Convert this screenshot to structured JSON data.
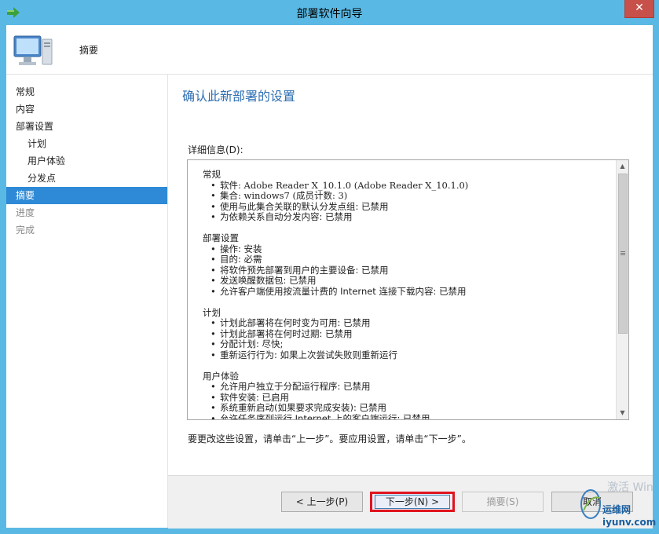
{
  "window": {
    "title": "部署软件向导",
    "close_label": "✕"
  },
  "header": {
    "title": "摘要"
  },
  "nav": {
    "items": [
      {
        "label": "常规"
      },
      {
        "label": "内容"
      },
      {
        "label": "部署设置"
      },
      {
        "label": "计划"
      },
      {
        "label": "用户体验"
      },
      {
        "label": "分发点"
      },
      {
        "label": "摘要"
      },
      {
        "label": "进度"
      },
      {
        "label": "完成"
      }
    ]
  },
  "main": {
    "heading": "确认此新部署的设置",
    "details_label": "详细信息(D):",
    "sections": [
      {
        "title": "常规",
        "items": [
          "软件: Adobe Reader X_10.1.0 (Adobe Reader X_10.1.0)",
          "集合: windows7 (成员计数: 3)",
          "使用与此集合关联的默认分发点组: 已禁用",
          "为依赖关系自动分发内容: 已禁用"
        ]
      },
      {
        "title": "部署设置",
        "items": [
          "操作: 安装",
          "目的: 必需",
          "将软件预先部署到用户的主要设备: 已禁用",
          "发送唤醒数据包: 已禁用",
          "允许客户端使用按流量计费的 Internet 连接下载内容: 已禁用"
        ]
      },
      {
        "title": "计划",
        "items": [
          "计划此部署将在何时变为可用: 已禁用",
          "计划此部署将在何时过期: 已禁用",
          "分配计划: 尽快;",
          "重新运行行为: 如果上次尝试失败则重新运行"
        ]
      },
      {
        "title": "用户体验",
        "items": [
          "允许用户独立于分配运行程序: 已禁用",
          "软件安装: 已启用",
          "系统重新启动(如果要求完成安装): 已禁用",
          "允许任务序列运行 Internet 上的客户端运行: 已禁用"
        ]
      }
    ],
    "hint": "要更改这些设置，请单击“上一步”。要应用设置，请单击“下一步”。"
  },
  "footer": {
    "prev_label": "< 上一步(P)",
    "next_label": "下一步(N) >",
    "summary_label": "摘要(S)",
    "cancel_label": "取消"
  },
  "watermark": {
    "line1": "激活 Win",
    "line2": "运维网",
    "line3": "iyunv.com"
  },
  "colors": {
    "titlebar": "#5ab9e4",
    "nav_active": "#2e8ad6",
    "heading": "#2e6fb3",
    "highlight": "#e0141e"
  }
}
